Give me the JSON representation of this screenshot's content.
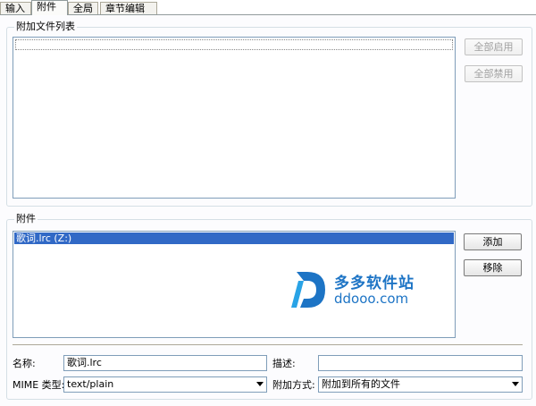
{
  "tabs": [
    "输入",
    "附件",
    "全局",
    "章节编辑器"
  ],
  "active_tab": "附件",
  "attach_file_list": {
    "title": "附加文件列表",
    "enable_all_button": "全部启用",
    "disable_all_button": "全部禁用"
  },
  "attachments": {
    "title": "附件",
    "items": [
      "歌词.lrc (Z:)"
    ],
    "add_button": "添加",
    "remove_button": "移除"
  },
  "form": {
    "name_label": "名称:",
    "name_value": "歌词.lrc",
    "desc_label": "描述:",
    "desc_value": "",
    "mime_label": "MIME 类型:",
    "mime_value": "text/plain",
    "attach_mode_label": "附加方式:",
    "attach_mode_value": "附加到所有的文件"
  },
  "watermark": {
    "site_name": "多多软件站",
    "domain": "ddooo.com",
    "color": "#1d74c5"
  }
}
